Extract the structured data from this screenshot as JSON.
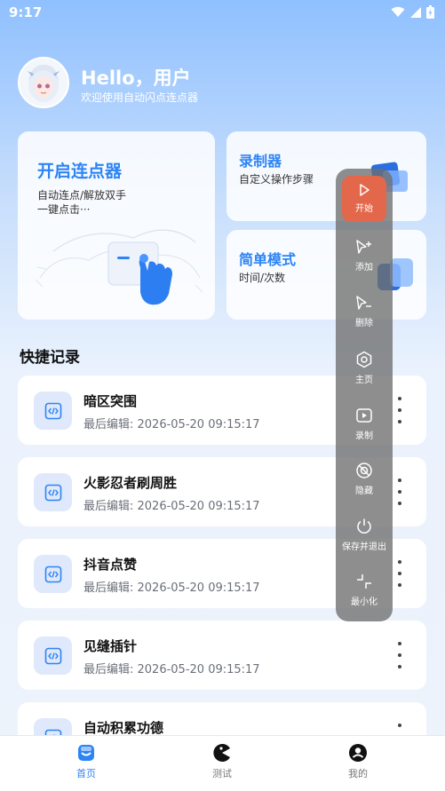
{
  "status": {
    "time": "9:17"
  },
  "header": {
    "greeting": "Hello，用户",
    "welcome": "欢迎使用自动闪点连点器"
  },
  "cards": {
    "start": {
      "title": "开启连点器",
      "line1": "自动连点/解放双手",
      "line2": "一键点击···"
    },
    "recorder": {
      "title": "录制器",
      "subtitle": "自定义操作步骤"
    },
    "simple": {
      "title": "简单模式",
      "subtitle": "时间/次数"
    }
  },
  "section": {
    "title": "快捷记录"
  },
  "records": [
    {
      "name": "暗区突围",
      "time": "最后编辑: 2026-05-20 09:15:17"
    },
    {
      "name": "火影忍者刷周胜",
      "time": "最后编辑: 2026-05-20 09:15:17"
    },
    {
      "name": "抖音点赞",
      "time": "最后编辑: 2026-05-20 09:15:17"
    },
    {
      "name": "见缝插针",
      "time": "最后编辑: 2026-05-20 09:15:17"
    },
    {
      "name": "自动积累功德",
      "time": ""
    }
  ],
  "floating_panel": {
    "start": "开始",
    "add": "添加",
    "delete": "删除",
    "home": "主页",
    "record": "录制",
    "hide": "隐藏",
    "save_exit": "保存并退出",
    "minimize": "最小化"
  },
  "tabs": [
    {
      "label": "首页",
      "icon": "home-icon",
      "active": true
    },
    {
      "label": "测试",
      "icon": "pacman-icon",
      "active": false
    },
    {
      "label": "我的",
      "icon": "profile-icon",
      "active": false
    }
  ],
  "colors": {
    "accent": "#2d84f5",
    "start_button": "#e3674a",
    "panel": "#6e6e6e"
  }
}
